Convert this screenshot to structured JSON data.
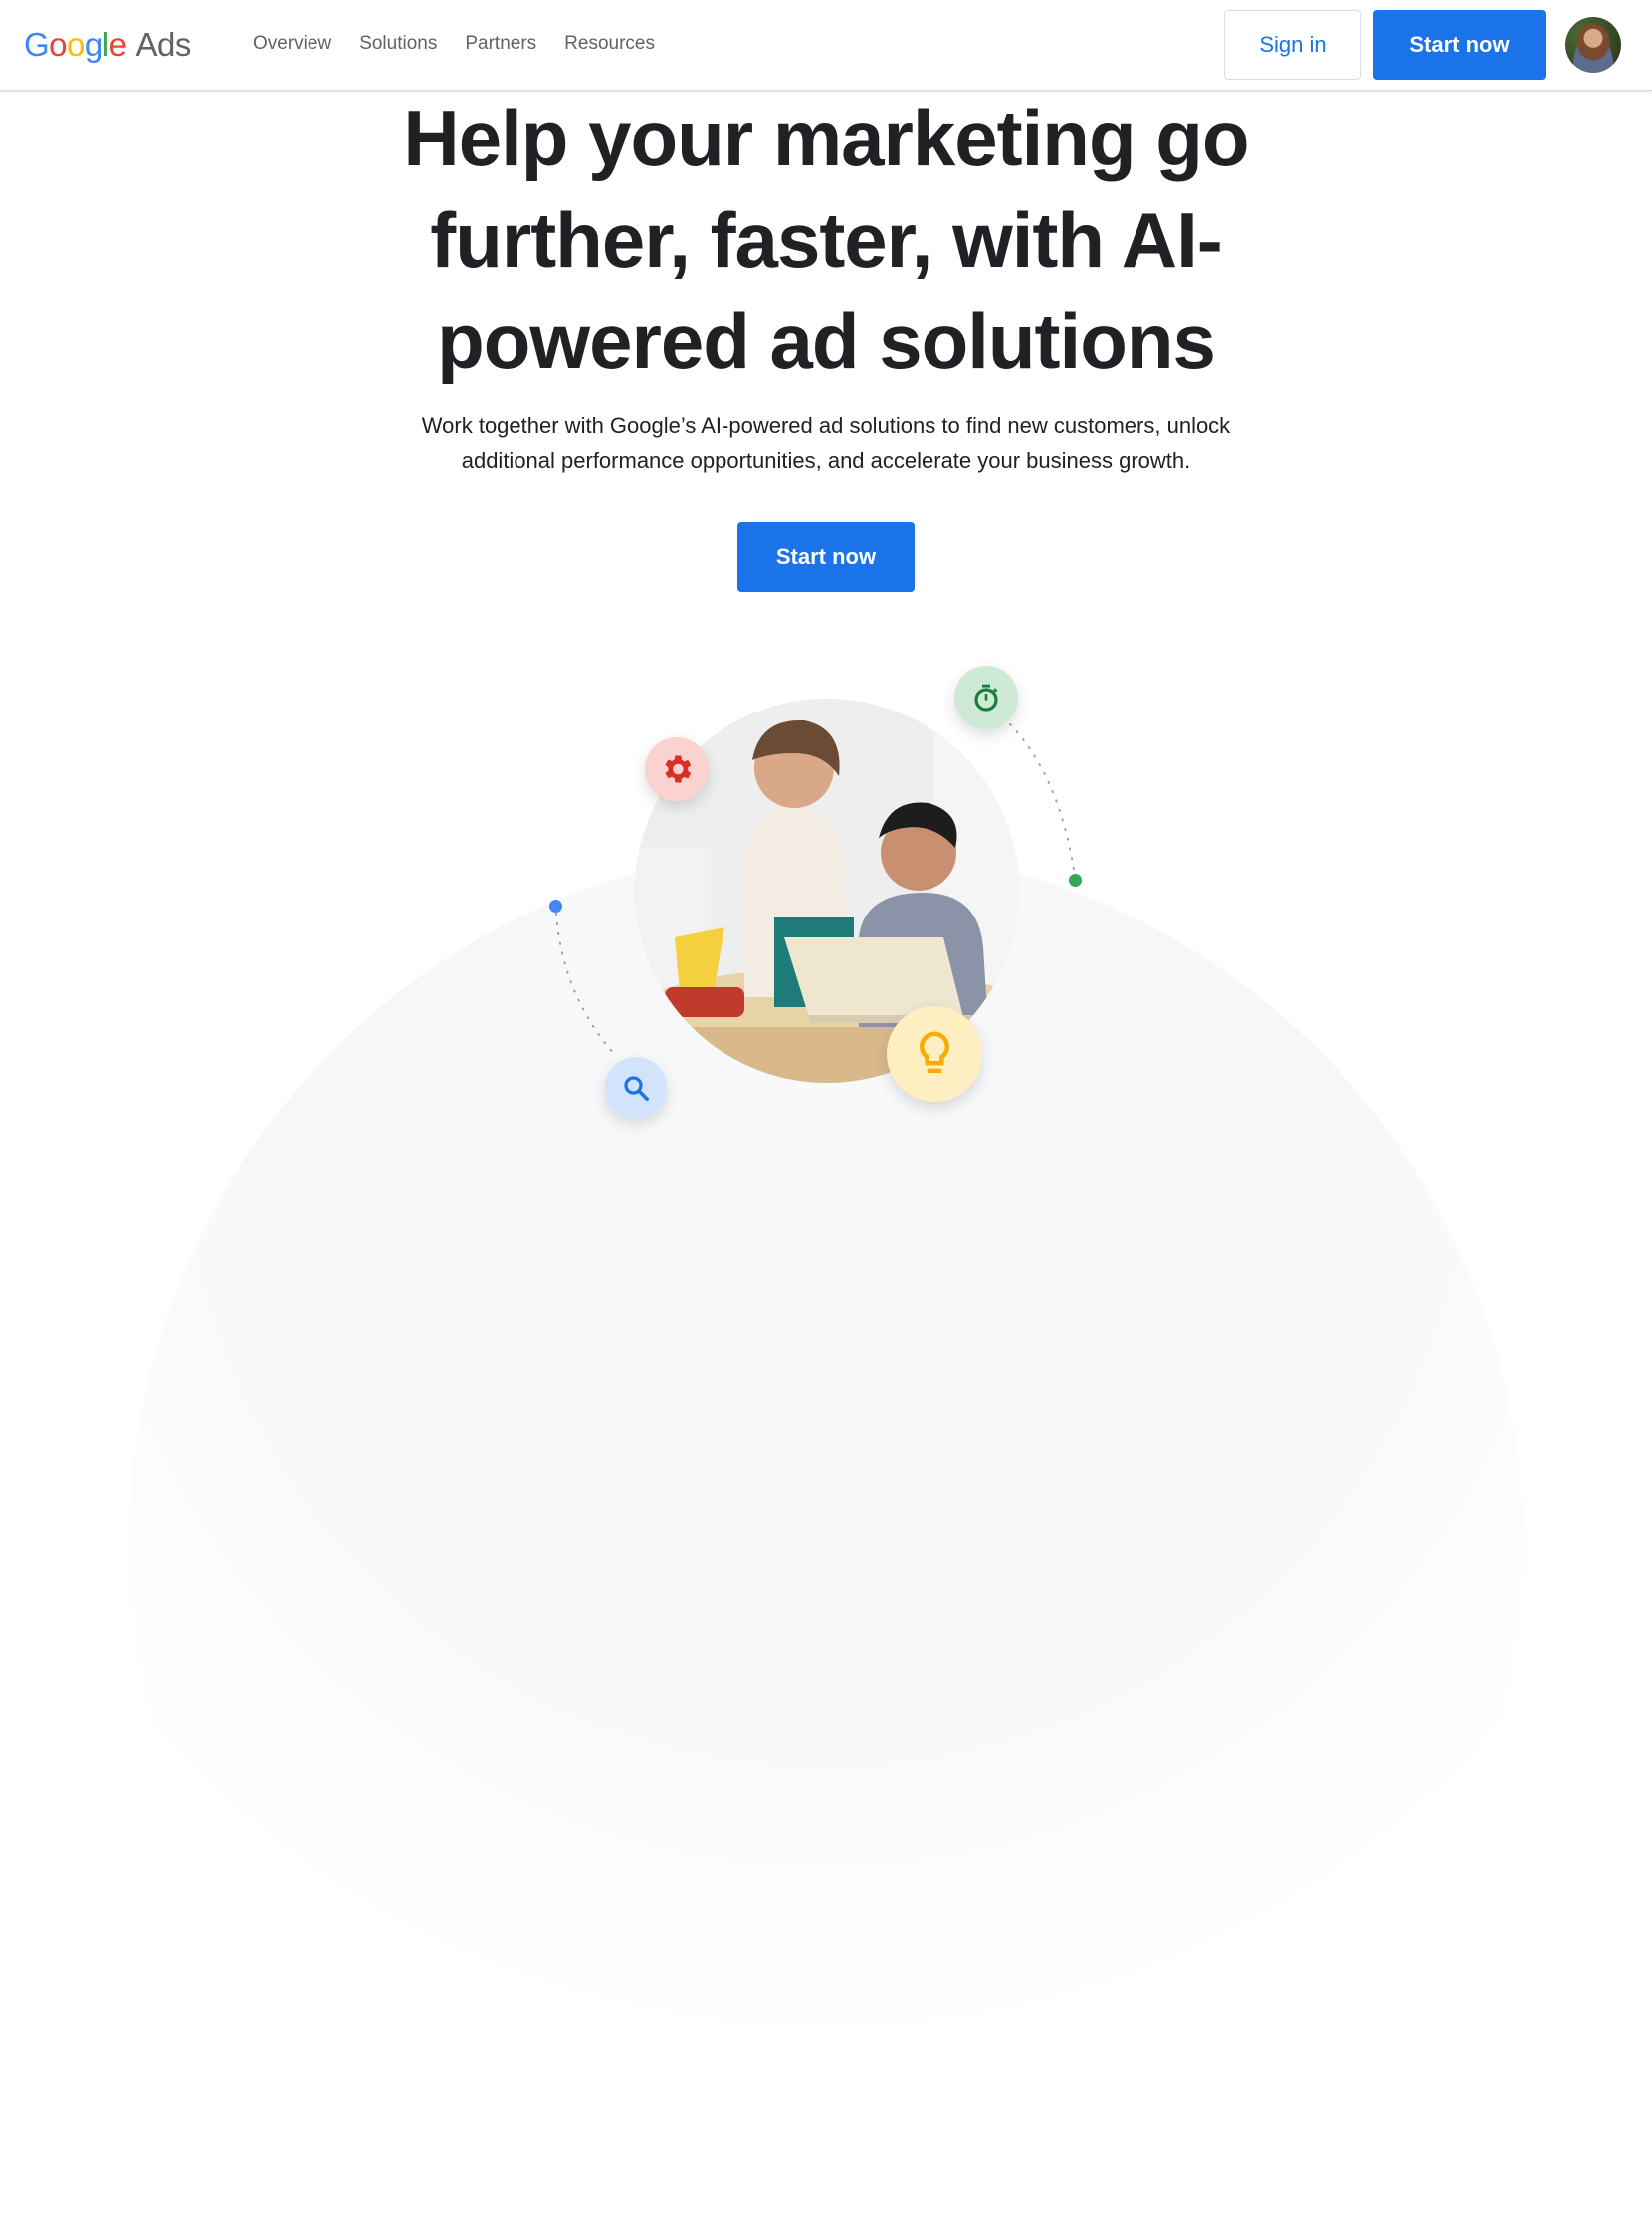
{
  "header": {
    "logo": {
      "google_letters": [
        {
          "char": "G",
          "color": "#4285F4"
        },
        {
          "char": "o",
          "color": "#EA4335"
        },
        {
          "char": "o",
          "color": "#FBBC05"
        },
        {
          "char": "g",
          "color": "#4285F4"
        },
        {
          "char": "l",
          "color": "#34A853"
        },
        {
          "char": "e",
          "color": "#EA4335"
        }
      ],
      "product": "Ads"
    },
    "nav": [
      "Overview",
      "Solutions",
      "Partners",
      "Resources"
    ],
    "sign_in_label": "Sign in",
    "start_now_label": "Start now",
    "avatar": "user-avatar"
  },
  "hero": {
    "title_lines": [
      "Help your marketing go",
      "further, faster, with AI-",
      "powered ad solutions"
    ],
    "subtitle_lines": [
      "Work together with Google’s AI-powered ad solutions to find new customers, unlock",
      "additional performance opportunities, and accelerate your business growth."
    ],
    "cta_label": "Start now"
  },
  "illustration": {
    "photo": "two-women-at-laptop",
    "bubbles": [
      {
        "icon": "gear-icon",
        "bg": "#fad2cf",
        "fg": "#d93025"
      },
      {
        "icon": "timer-icon",
        "bg": "#ceead6",
        "fg": "#188038"
      },
      {
        "icon": "lightbulb-icon",
        "bg": "#feefc3",
        "fg": "#f9ab00"
      },
      {
        "icon": "search-icon",
        "bg": "#d2e3fc",
        "fg": "#1a73e8"
      }
    ],
    "dots": [
      {
        "name": "blue-dot",
        "color": "#4285f4"
      },
      {
        "name": "green-dot",
        "color": "#34a853"
      }
    ]
  },
  "colors": {
    "accent": "#1a73e8",
    "text": "#202124",
    "muted": "#5f6368"
  }
}
